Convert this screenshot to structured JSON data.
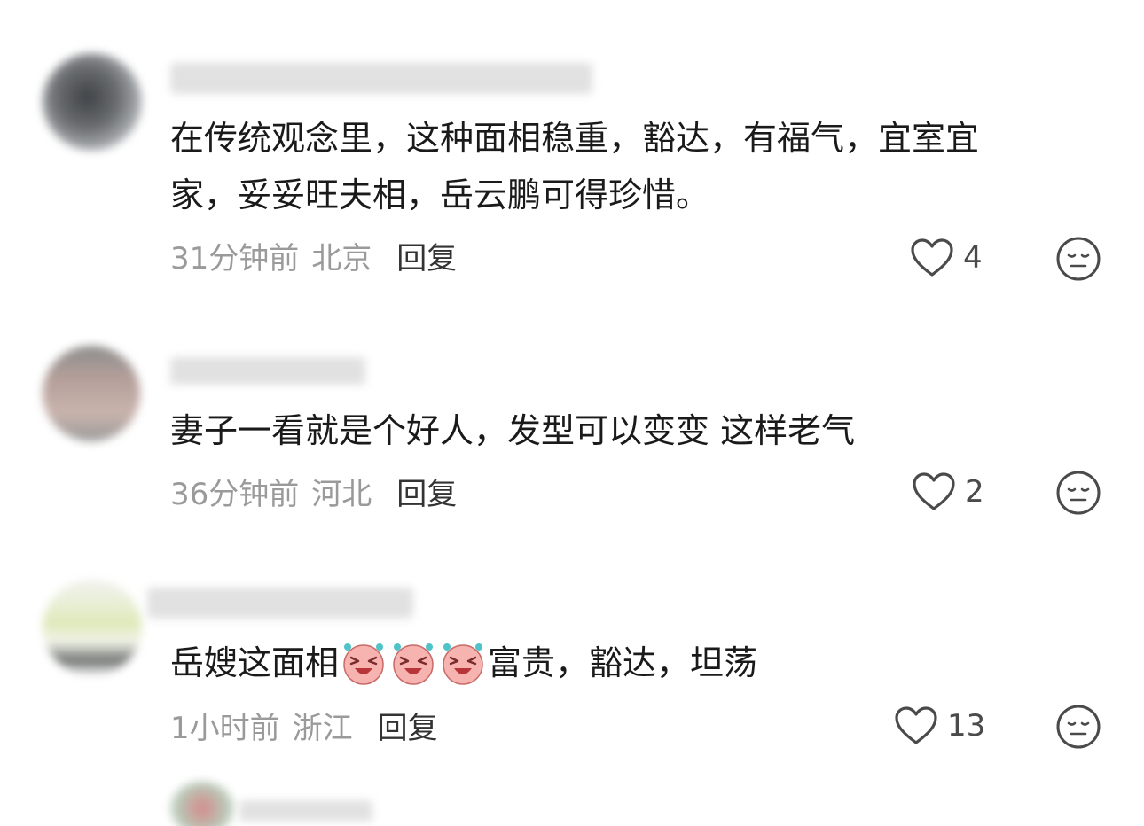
{
  "comments": [
    {
      "text_lines": [
        "在传统观念里，这种面相稳重，豁达，有福气，宜室宜",
        "家，妥妥旺夫相，岳云鹏可得珍惜。"
      ],
      "time": "31分钟前",
      "location": "北京",
      "reply_label": "回复",
      "likes": "4"
    },
    {
      "text_lines": [
        "妻子一看就是个好人，发型可以变变 这样老气"
      ],
      "time": "36分钟前",
      "location": "河北",
      "reply_label": "回复",
      "likes": "2"
    },
    {
      "text_before_emoji": "岳嫂这面相",
      "emoji_count": 3,
      "text_after_emoji": "富贵，豁达，坦荡",
      "time": "1小时前",
      "location": "浙江",
      "reply_label": "回复",
      "likes": "13"
    }
  ],
  "icons": {
    "like": "heart-outline-icon",
    "reaction": "meh-face-icon",
    "emoji": "laughing-pink-face-emoji"
  },
  "colors": {
    "text": "#1a1a1a",
    "meta": "#9a9a9a",
    "reply": "#333333",
    "icon": "#4a4a4a"
  }
}
